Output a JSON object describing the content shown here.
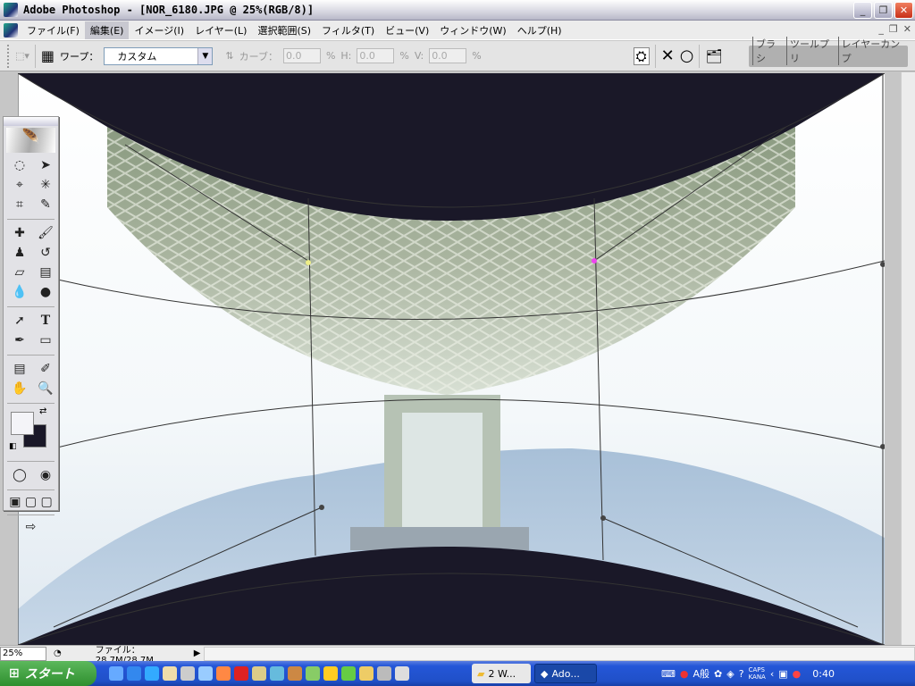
{
  "window": {
    "title": "Adobe Photoshop - [NOR_6180.JPG @ 25%(RGB/8)]",
    "min": "_",
    "restore": "❐",
    "close": "✕"
  },
  "menu": {
    "items": [
      "ファイル(F)",
      "編集(E)",
      "イメージ(I)",
      "レイヤー(L)",
      "選択範囲(S)",
      "フィルタ(T)",
      "ビュー(V)",
      "ウィンドウ(W)",
      "ヘルプ(H)"
    ],
    "active_index": 1
  },
  "options": {
    "warp_label": "ワープ：",
    "warp_value": "カスタム",
    "curve_label": "カーブ：",
    "curve_value": "0.0",
    "h_label": "H:",
    "h_value": "0.0",
    "v_label": "V:",
    "v_value": "0.0",
    "pct": "%",
    "cancel": "✕",
    "commit": "○"
  },
  "panel_well": {
    "tabs": [
      "ブラシ",
      "ツールプリ",
      "レイヤーカンプ"
    ]
  },
  "status": {
    "zoom": "25%",
    "file_info": "ファイル：28.7M/28.7M"
  },
  "taskbar": {
    "start": "スタート",
    "tasks": [
      {
        "label": "2 W..."
      },
      {
        "label": "Ado..."
      }
    ],
    "ime": "A般",
    "caps": "CAPS",
    "kana": "KANA",
    "clock": "0:40"
  },
  "colors": {
    "foreground": "#f4f4f8",
    "background": "#1a1828"
  }
}
